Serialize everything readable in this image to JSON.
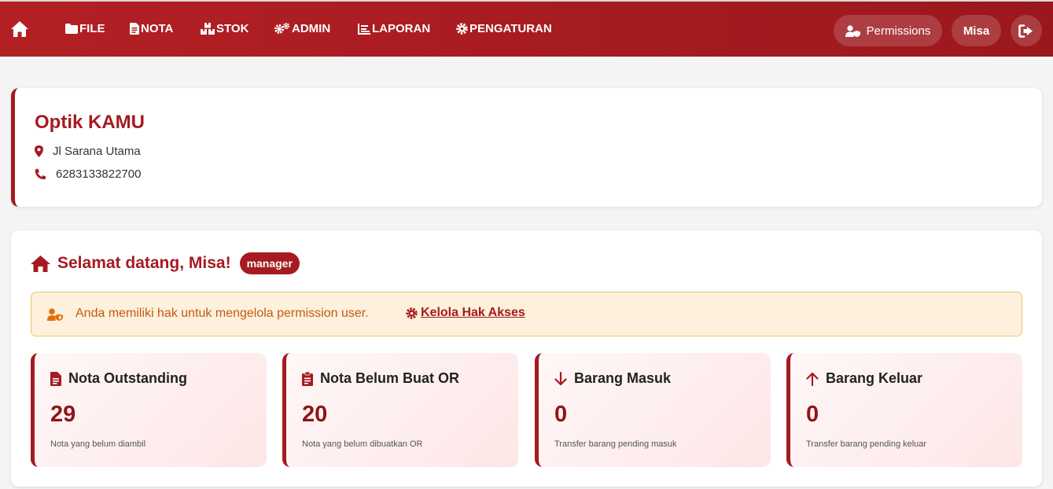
{
  "nav": {
    "items": [
      {
        "label": "FILE",
        "icon": "folder-icon"
      },
      {
        "label": "NOTA",
        "icon": "file-invoice-icon"
      },
      {
        "label": "STOK",
        "icon": "boxes-icon"
      },
      {
        "label": "ADMIN",
        "icon": "cogs-icon"
      },
      {
        "label": "LAPORAN",
        "icon": "chart-icon"
      },
      {
        "label": "PENGATURAN",
        "icon": "gear-icon"
      }
    ],
    "permissions_label": "Permissions",
    "user_label": "Misa"
  },
  "store": {
    "name": "Optik KAMU",
    "address": "Jl Sarana Utama",
    "phone": "6283133822700"
  },
  "welcome": {
    "greeting": "Selamat datang, Misa!",
    "role_badge": "manager",
    "alert_text": "Anda memiliki hak untuk mengelola permission user.",
    "alert_link": "Kelola Hak Akses"
  },
  "stats": [
    {
      "title": "Nota Outstanding",
      "value": "29",
      "desc": "Nota yang belum diambil",
      "icon": "file-icon"
    },
    {
      "title": "Nota Belum Buat OR",
      "value": "20",
      "desc": "Nota yang belum dibuatkan OR",
      "icon": "clipboard-icon"
    },
    {
      "title": "Barang Masuk",
      "value": "0",
      "desc": "Transfer barang pending masuk",
      "icon": "arrow-down-icon"
    },
    {
      "title": "Barang Keluar",
      "value": "0",
      "desc": "Transfer barang pending keluar",
      "icon": "arrow-up-icon"
    }
  ],
  "colors": {
    "primary": "#a51b20",
    "alert_bg": "#fdf0dc",
    "alert_text": "#c55a11"
  }
}
